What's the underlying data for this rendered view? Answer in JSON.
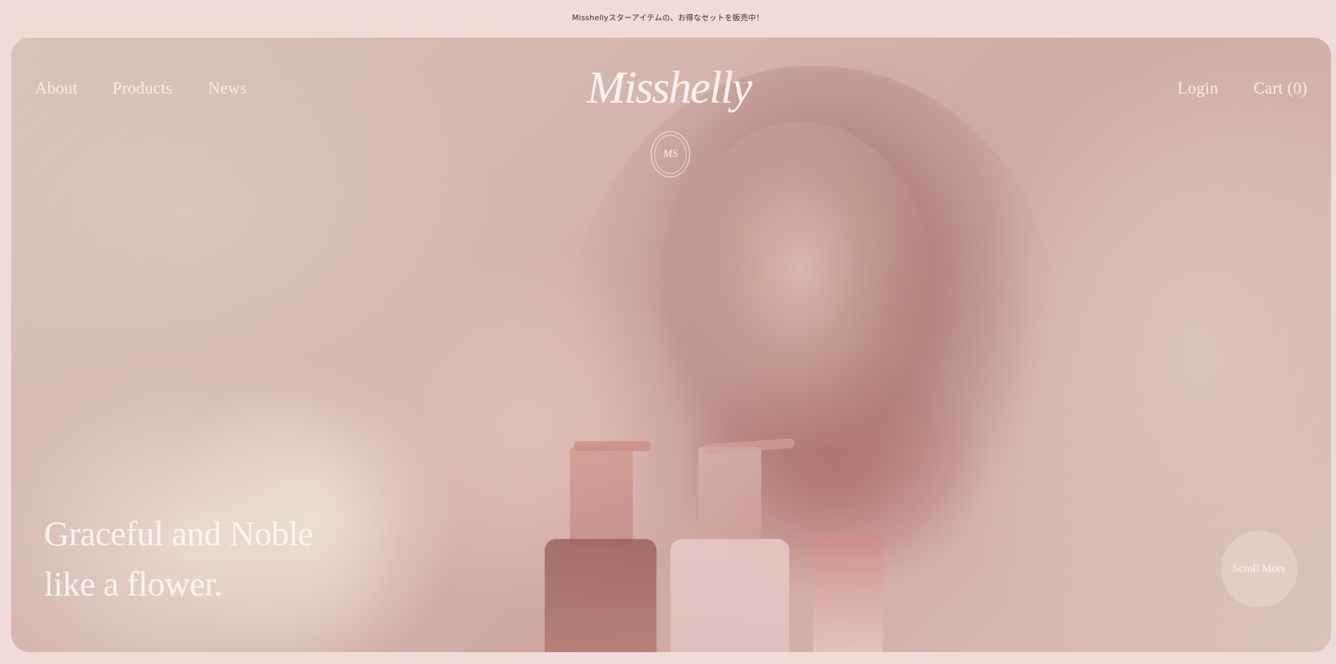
{
  "announcement": {
    "text": "Misshellyスターアイテムの、お得なセットを販売中！"
  },
  "nav": {
    "about": "About",
    "products": "Products",
    "news": "News",
    "login": "Login",
    "cart": "Cart (0)"
  },
  "brand": {
    "logo_text": "Misshelly",
    "emblem_text": "MS"
  },
  "hero": {
    "tagline_line1": "Graceful and Noble",
    "tagline_line2": "like a flower.",
    "scroll_more": "Scroll More"
  },
  "colors": {
    "page_background": "#efdcd8",
    "hero_tint": "#d4b1aa",
    "text_light": "#f6ecea",
    "announcement_text": "#3a2a28"
  }
}
